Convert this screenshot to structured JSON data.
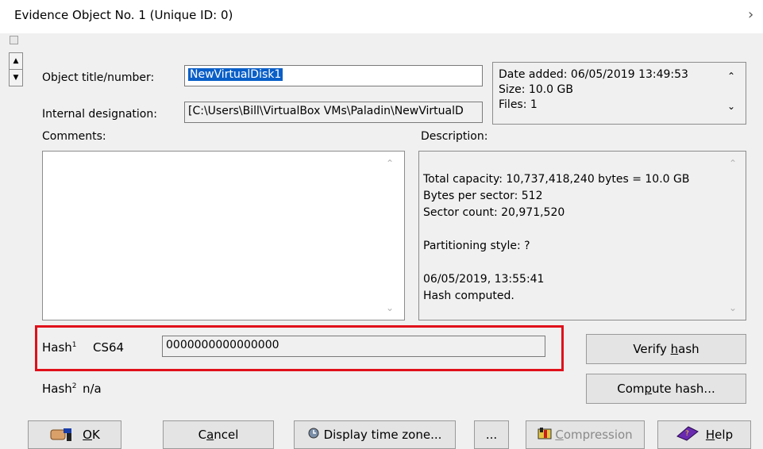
{
  "window": {
    "title": "Evidence Object No. 1 (Unique ID: 0)"
  },
  "object": {
    "title_label": "Object title/number:",
    "title_value": "NewVirtualDisk1",
    "designation_label": "Internal designation:",
    "designation_value": "[C:\\Users\\Bill\\VirtualBox VMs\\Paladin\\NewVirtualD",
    "comments_label": "Comments:",
    "description_label": "Description:"
  },
  "info": {
    "date_added": "Date added: 06/05/2019   13:49:53",
    "size": "Size: 10.0 GB",
    "files": "Files: 1"
  },
  "description": {
    "total_capacity": "Total capacity: 10,737,418,240 bytes = 10.0 GB",
    "bytes_per_sector": "Bytes per sector: 512",
    "sector_count": "Sector count: 20,971,520",
    "partitioning": "Partitioning style: ?",
    "timestamp": "06/05/2019, 13:55:41",
    "hash_status": "Hash computed."
  },
  "hash": {
    "hash1_label": "Hash",
    "hash1_sup": "1",
    "hash1_type": "CS64",
    "hash1_value": "0000000000000000",
    "hash2_label": "Hash",
    "hash2_sup": "2",
    "hash2_value": "n/a",
    "verify_pre": "Verify ",
    "verify_u": "h",
    "verify_post": "ash",
    "compute_pre": "Com",
    "compute_u": "p",
    "compute_post": "ute hash..."
  },
  "buttons": {
    "ok_u": "O",
    "ok_post": "K",
    "cancel_pre": "C",
    "cancel_u": "a",
    "cancel_post": "ncel",
    "timezone": "Display time zone...",
    "more": "...",
    "compression_u": "C",
    "compression_post": "ompression",
    "help_u": "H",
    "help_post": "elp"
  },
  "colors": {
    "highlight": "#e0101a",
    "selection": "#0a5fc8"
  },
  "icons": [
    "close-chevron-icon",
    "spin-up-icon",
    "spin-down-icon",
    "clock-icon",
    "ok-hand-icon",
    "compression-icon",
    "help-book-icon"
  ]
}
